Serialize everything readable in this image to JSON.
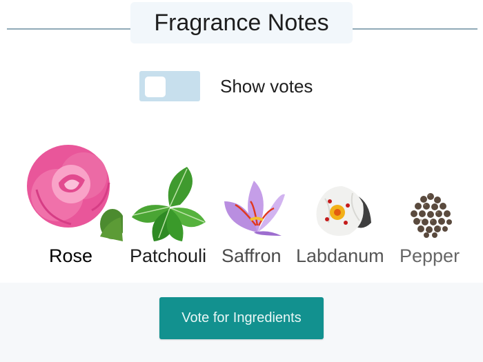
{
  "header": {
    "title": "Fragrance Notes"
  },
  "toggle": {
    "label": "Show votes",
    "on": false
  },
  "notes": [
    {
      "name": "Rose",
      "icon": "rose-flower-icon",
      "label_color": "#1e1e1e"
    },
    {
      "name": "Patchouli",
      "icon": "patchouli-leaves-icon",
      "label_color": "#1e1e1e"
    },
    {
      "name": "Saffron",
      "icon": "saffron-crocus-icon",
      "label_color": "#4a4a4a"
    },
    {
      "name": "Labdanum",
      "icon": "labdanum-cistus-icon",
      "label_color": "#555555"
    },
    {
      "name": "Pepper",
      "icon": "black-pepper-icon",
      "label_color": "#666666"
    }
  ],
  "vote_button": {
    "label": "Vote for Ingredients"
  },
  "colors": {
    "accent": "#12918f",
    "toggle_track": "#c7dfed",
    "header_line": "#8fa9b7"
  }
}
